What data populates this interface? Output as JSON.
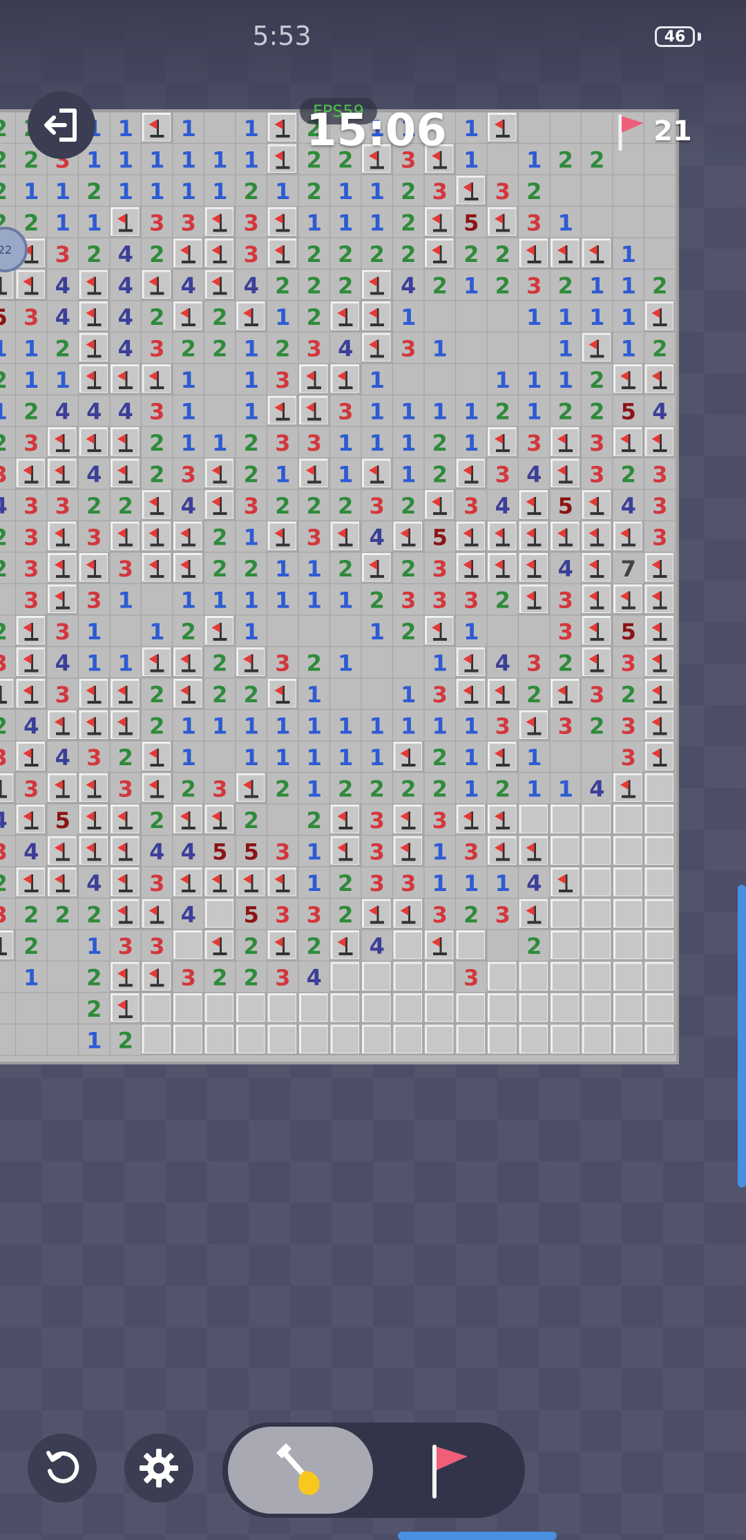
{
  "status_bar": {
    "time": "5:53",
    "battery": "46"
  },
  "hud": {
    "fps": "FPS59",
    "timer": "15:06",
    "flags_remaining": "21",
    "side_badge": "22"
  },
  "colors": {
    "n1": "#2d5bd3",
    "n2": "#2e8b3a",
    "n3": "#d3373c",
    "n4": "#3b3f98",
    "n5": "#8b1414",
    "n6": "#157f80",
    "n7": "#444444",
    "tile_raised": "#c7c7c7",
    "tile_open": "#bdbdbd",
    "grid_line": "#a6a6a6",
    "flag": "#e53935"
  },
  "icons": {
    "exit": "exit-door-icon",
    "flag": "flag-icon",
    "restart": "restart-icon",
    "settings": "gear-icon",
    "dig": "shovel-icon",
    "side": "badge-icon"
  },
  "board": {
    "legend": "digits = count, F = flag, . = open empty, # = unopened",
    "rows": [
      "22F11F1.1F2.11.1F.",
      "223111111F22F3F1.122",
      "211211112121123F32...",
      "2211F33F3F1112F5F31...",
      "2F3242FF3F2222F22FFF1.11",
      "FF4F4F4F4222F421232112F",
      "534F42F2F12FF1...1111F3",
      "112F43221234F31...1F12F4F",
      "211FFF1.13FF1...1112FF",
      "1244431.1FF31111212254F4",
      "23FFF21123311121F3F3FFF2",
      "3FF4F23F21F1F12F34F32321",
      "43322F4F322232F34F5F4321.",
      "23F3FFF21F3F4F5FFFFFF32",
      "23FF3FF22112F23FFF4F7FFF",
      ".3F31.11111123332F3FFF43",
      "2F31.12F1...12F1..3F5F23F",
      "3F411FF2F321..1F432F3F214F",
      "FF3FF2F22F1..13FF2F32F2F2F",
      "24FFF211111111113F323F44F#",
      "3F432F1.11111F21F1..3FFFF3#",
      "F3FF3F23F21222212114F#####",
      "4F5FF2FF2.2F3F3FF########",
      "34FFF445531F3F13FF#######",
      "2FF4F3FFFF12331114F######",
      "3222FF4#5332FF323F#######",
      "F2.133#F2F2F4#F#.2#######",
      ".1.2FF32234####3#########",
      "...2F####################",
      "...12####################"
    ]
  }
}
